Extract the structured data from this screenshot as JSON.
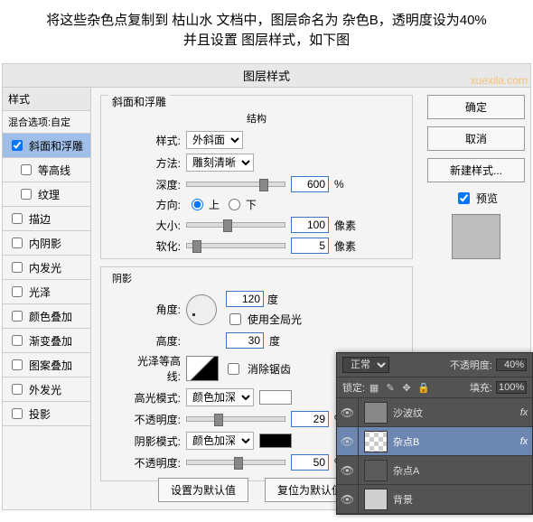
{
  "instructions": {
    "line1": "将这些杂色点复制到 枯山水 文档中，图层命名为 杂色B，透明度设为40%",
    "line2": "并且设置 图层样式，如下图"
  },
  "watermark": "xuexila.com",
  "dialog": {
    "title": "图层样式",
    "sidebar": {
      "header": "样式",
      "blend": "混合选项:自定",
      "items": [
        {
          "label": "斜面和浮雕",
          "checked": true,
          "selected": true
        },
        {
          "label": "等高线",
          "checked": false,
          "indent": true
        },
        {
          "label": "纹理",
          "checked": false,
          "indent": true
        },
        {
          "label": "描边",
          "checked": false
        },
        {
          "label": "内阴影",
          "checked": false
        },
        {
          "label": "内发光",
          "checked": false
        },
        {
          "label": "光泽",
          "checked": false
        },
        {
          "label": "颜色叠加",
          "checked": false
        },
        {
          "label": "渐变叠加",
          "checked": false
        },
        {
          "label": "图案叠加",
          "checked": false
        },
        {
          "label": "外发光",
          "checked": false
        },
        {
          "label": "投影",
          "checked": false
        }
      ]
    },
    "bevel": {
      "group_label": "斜面和浮雕",
      "structure": {
        "heading": "结构",
        "style_label": "样式:",
        "style_value": "外斜面",
        "technique_label": "方法:",
        "technique_value": "雕刻清晰",
        "depth_label": "深度:",
        "depth_value": "600",
        "depth_unit": "%",
        "direction_label": "方向:",
        "direction_up": "上",
        "direction_down": "下",
        "direction_value": "up",
        "size_label": "大小:",
        "size_value": "100",
        "size_unit": "像素",
        "soften_label": "软化:",
        "soften_value": "5",
        "soften_unit": "像素"
      },
      "shading": {
        "heading": "阴影",
        "angle_label": "角度:",
        "angle_value": "120",
        "angle_unit": "度",
        "global_light_label": "使用全局光",
        "global_light": false,
        "altitude_label": "高度:",
        "altitude_value": "30",
        "altitude_unit": "度",
        "gloss_contour_label": "光泽等高线:",
        "antialias_label": "消除锯齿",
        "antialias": false,
        "highlight_mode_label": "高光模式:",
        "highlight_mode": "颜色加深",
        "highlight_opacity_label": "不透明度:",
        "highlight_opacity": "29",
        "highlight_opacity_unit": "%",
        "shadow_mode_label": "阴影模式:",
        "shadow_mode": "颜色加深",
        "shadow_opacity_label": "不透明度:",
        "shadow_opacity": "50",
        "shadow_opacity_unit": "%"
      },
      "buttons": {
        "make_default": "设置为默认值",
        "reset_default": "复位为默认值"
      }
    },
    "buttons": {
      "ok": "确定",
      "cancel": "取消",
      "new_style": "新建样式...",
      "preview_label": "预览"
    }
  },
  "layers_panel": {
    "blend_mode": "正常",
    "opacity_label": "不透明度:",
    "opacity_value": "40%",
    "lock_label": "锁定:",
    "fill_label": "填充:",
    "fill_value": "100%",
    "layers": [
      {
        "name": "沙波纹",
        "fx": true
      },
      {
        "name": "杂点B",
        "fx": true,
        "selected": true
      },
      {
        "name": "杂点A"
      },
      {
        "name": "背景"
      }
    ]
  }
}
